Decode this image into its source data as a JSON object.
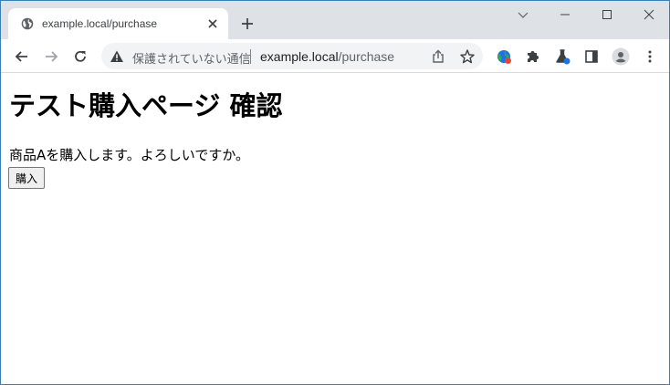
{
  "tab": {
    "title": "example.local/purchase"
  },
  "omnibox": {
    "security_text": "保護されていない通信",
    "url_host": "example.local",
    "url_path": "/purchase"
  },
  "page": {
    "heading": "テスト購入ページ 確認",
    "message": "商品Aを購入します。よろしいですか。",
    "buy_button_label": "購入"
  },
  "icons": {
    "favicon": "globe-icon",
    "tab_close": "close-icon",
    "new_tab": "plus-icon",
    "tab_search": "chevron-down-icon",
    "minimize": "minimize-icon",
    "maximize": "maximize-icon",
    "window_close": "close-icon",
    "back": "back-arrow-icon",
    "forward": "forward-arrow-icon",
    "reload": "reload-icon",
    "security": "warning-icon",
    "share": "share-icon",
    "bookmark": "star-icon",
    "extension_globe": "globe-extension-icon",
    "extensions": "puzzle-icon",
    "labs": "flask-icon",
    "side_panel": "side-panel-icon",
    "profile": "avatar-icon",
    "menu": "kebab-menu-icon"
  },
  "colors": {
    "tabstrip_bg": "#dee1e6",
    "omnibox_bg": "#f1f3f4",
    "window_border": "#3c7fb1",
    "icon_gray": "#5f6368"
  }
}
